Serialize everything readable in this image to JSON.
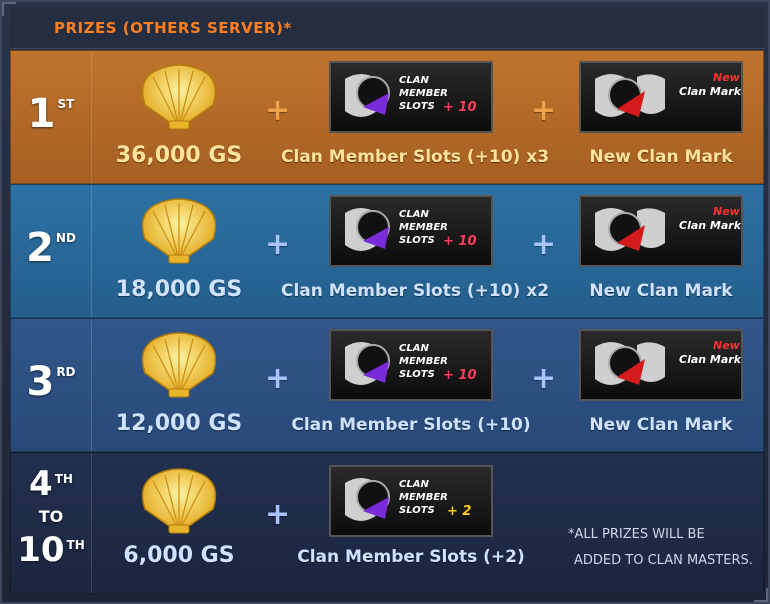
{
  "header": {
    "title": "Prizes (Others Server)*"
  },
  "colors": {
    "first_bg": "#b46a26",
    "second_bg": "#2a6796",
    "third_bg": "#2d4f7f",
    "fourth_bg": "#1f2a44",
    "plus_orange": "#f0a24a",
    "plus_blue": "#a8c3ff"
  },
  "rows": [
    {
      "rank": "1",
      "suffix": "ST",
      "gs": "36,000 GS",
      "item1": {
        "title_line1": "CLAN",
        "title_line2": "MEMBER",
        "title_line3": "SLOTS",
        "bonus": "+ 10",
        "caption": "Clan Member Slots (+10) x3"
      },
      "item2": {
        "tag": "New",
        "title": "Clan Mark",
        "caption": "New Clan Mark"
      }
    },
    {
      "rank": "2",
      "suffix": "ND",
      "gs": "18,000 GS",
      "item1": {
        "title_line1": "CLAN",
        "title_line2": "MEMBER",
        "title_line3": "SLOTS",
        "bonus": "+ 10",
        "caption": "Clan Member Slots (+10) x2"
      },
      "item2": {
        "tag": "New",
        "title": "Clan Mark",
        "caption": "New Clan Mark"
      }
    },
    {
      "rank": "3",
      "suffix": "RD",
      "gs": "12,000 GS",
      "item1": {
        "title_line1": "CLAN",
        "title_line2": "MEMBER",
        "title_line3": "SLOTS",
        "bonus": "+ 10",
        "caption": "Clan Member Slots (+10)"
      },
      "item2": {
        "tag": "New",
        "title": "Clan Mark",
        "caption": "New Clan Mark"
      }
    },
    {
      "rank_top": "4",
      "rank_top_suffix": "TH",
      "rank_to": "TO",
      "rank_bottom": "10",
      "rank_bottom_suffix": "TH",
      "gs": "6,000 GS",
      "item1": {
        "title_line1": "CLAN",
        "title_line2": "MEMBER",
        "title_line3": "SLOTS",
        "bonus": "+ 2",
        "caption": "Clan Member Slots (+2)"
      }
    }
  ],
  "note": {
    "line1": "*ALL PRIZES WILL BE",
    "line2": "ADDED TO CLAN MASTERS."
  }
}
